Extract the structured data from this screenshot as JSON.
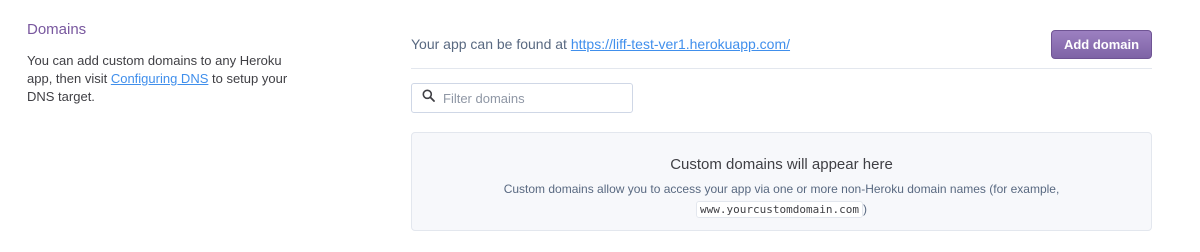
{
  "domains": {
    "title": "Domains",
    "description_pre": "You can add custom domains to any Heroku app, then visit ",
    "description_link": "Configuring DNS",
    "description_post": " to setup your DNS target."
  },
  "app_url": {
    "prefix": "Your app can be found at ",
    "url": "https://liff-test-ver1.herokuapp.com/"
  },
  "add_button": {
    "label": "Add domain"
  },
  "filter": {
    "placeholder": "Filter domains",
    "value": "",
    "icon": "search-icon"
  },
  "empty_state": {
    "title": "Custom domains will appear here",
    "desc_pre": "Custom domains allow you to access your app via one or more non-Heroku domain names (for example, ",
    "example": "www.yourcustomdomain.com",
    "desc_post": ")"
  },
  "colors": {
    "accent": "#79589f",
    "link": "#408fec"
  }
}
